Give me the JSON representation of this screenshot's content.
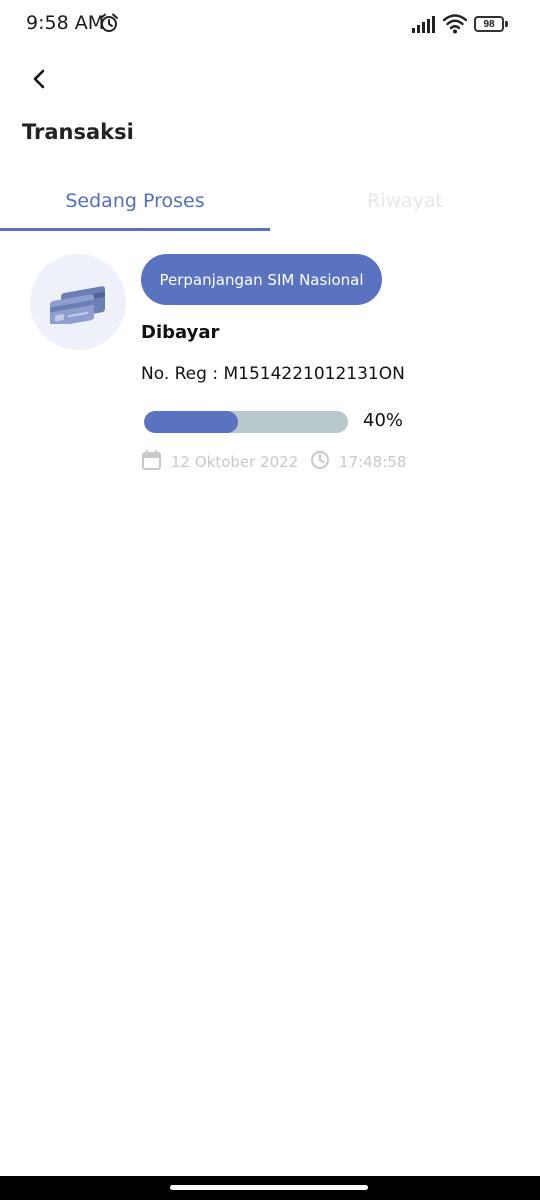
{
  "status_bar": {
    "time": "9:58 AM",
    "battery_level": "98",
    "icons": [
      "alarm-icon",
      "signal-icon",
      "wifi-icon",
      "battery-icon"
    ]
  },
  "header": {
    "back_icon": "chevron-left-icon",
    "title": "Transaksi"
  },
  "tabs": [
    {
      "label": "Sedang Proses",
      "active": true
    },
    {
      "label": "Riwayat",
      "active": false
    }
  ],
  "transaction": {
    "icon": "credit-card-icon",
    "service": "Perpanjangan SIM Nasional",
    "status": "Dibayar",
    "reg_label": "No. Reg : M1514221012131ON",
    "progress": 0.4,
    "progress_label": "40%",
    "date": "12 Oktober 2022",
    "time": "17:48:58"
  },
  "colors": {
    "accent": "#5a73c0",
    "tab_active": "#5470bd",
    "progress_track": "#b9c8cd",
    "muted_text": "#c9c9cc"
  }
}
